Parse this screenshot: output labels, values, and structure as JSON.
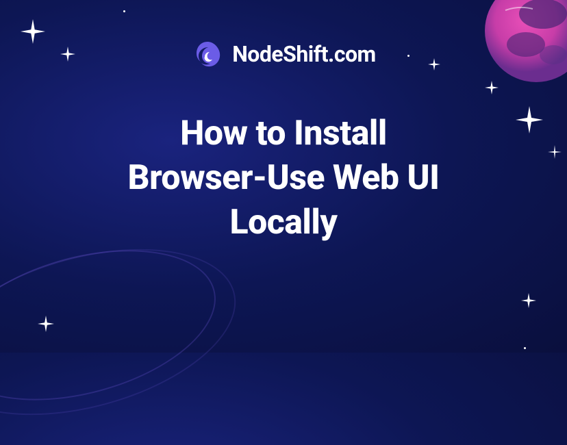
{
  "brand": {
    "name": "NodeShift.com",
    "icon": "nodeshift-logo"
  },
  "title": {
    "line1": "How to Install",
    "line2": "Browser-Use Web UI",
    "line3": "Locally"
  },
  "decorations": {
    "planet": "planet-icon",
    "stars": [
      {
        "name": "star-1"
      },
      {
        "name": "star-2"
      },
      {
        "name": "star-3"
      },
      {
        "name": "star-4"
      },
      {
        "name": "star-5"
      },
      {
        "name": "star-6"
      },
      {
        "name": "star-7"
      },
      {
        "name": "star-8"
      }
    ]
  }
}
